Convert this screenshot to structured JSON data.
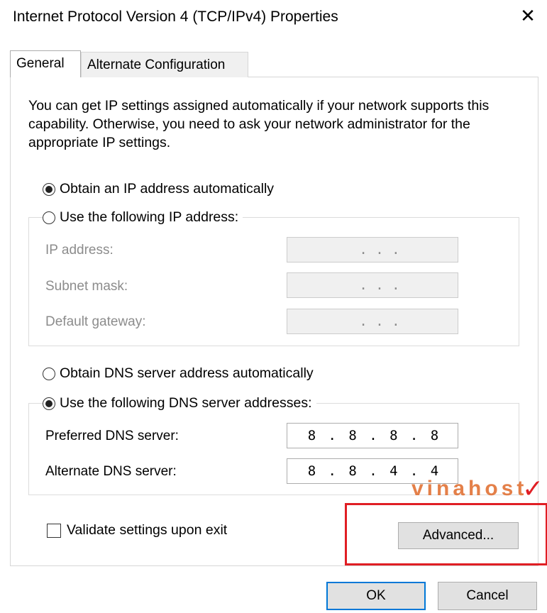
{
  "window": {
    "title": "Internet Protocol Version 4 (TCP/IPv4) Properties",
    "close_glyph": "✕"
  },
  "tabs": [
    {
      "label": "General",
      "selected": true
    },
    {
      "label": "Alternate Configuration",
      "selected": false
    }
  ],
  "description": "You can get IP settings assigned automatically if your network supports this capability. Otherwise, you need to ask your network administrator for the appropriate IP settings.",
  "ip_section": {
    "auto_label": "Obtain an IP address automatically",
    "auto_selected": true,
    "manual_label": "Use the following IP address:",
    "manual_selected": false,
    "fields": [
      {
        "label": "IP address:",
        "value": ".     .     ."
      },
      {
        "label": "Subnet mask:",
        "value": ".     .     ."
      },
      {
        "label": "Default gateway:",
        "value": ".     .     ."
      }
    ]
  },
  "dns_section": {
    "auto_label": "Obtain DNS server address automatically",
    "auto_selected": false,
    "manual_label": "Use the following DNS server addresses:",
    "manual_selected": true,
    "fields": [
      {
        "label": "Preferred DNS server:",
        "octets": [
          "8",
          ".",
          "8",
          ".",
          "8",
          ".",
          "8"
        ]
      },
      {
        "label": "Alternate DNS server:",
        "octets": [
          "8",
          ".",
          "8",
          ".",
          "4",
          ".",
          "4"
        ]
      }
    ]
  },
  "validate": {
    "label": "Validate settings upon exit",
    "checked": false
  },
  "buttons": {
    "advanced": "Advanced...",
    "ok": "OK",
    "cancel": "Cancel"
  },
  "watermark": {
    "text": "vinahost",
    "mark": "✓"
  },
  "colors": {
    "highlight": "#e01e24",
    "ok_border": "#0078d7",
    "watermark": "#e06a2a"
  }
}
